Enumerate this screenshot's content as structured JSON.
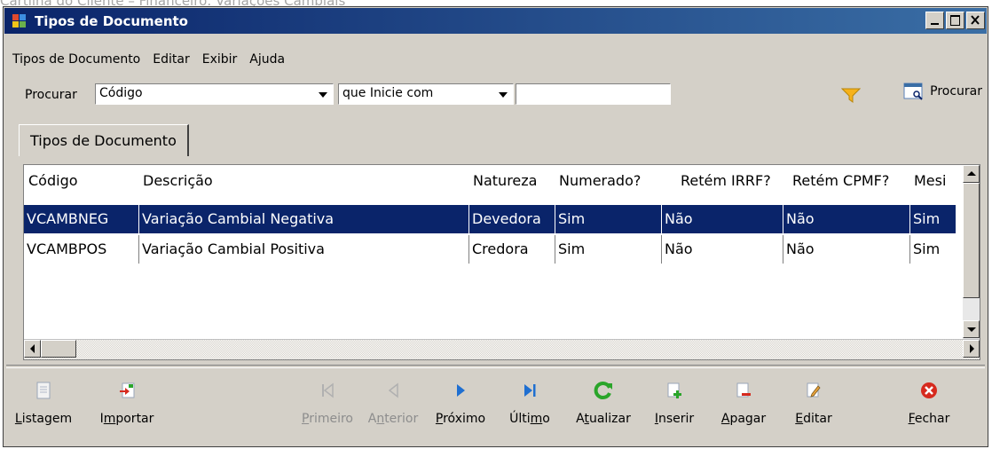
{
  "background_caption": "Cartilha do Cliente – Financeiro: Variações Cambiais",
  "window": {
    "title": "Tipos de Documento"
  },
  "menu": [
    "Tipos de Documento",
    "Editar",
    "Exibir",
    "Ajuda"
  ],
  "search": {
    "label": "Procurar",
    "field_value": "Código",
    "condition_value": "que Inicie com",
    "text_value": "",
    "button_label": "Procurar"
  },
  "tab": {
    "label": "Tipos de Documento"
  },
  "table": {
    "columns": [
      "Código",
      "Descrição",
      "Natureza",
      "Numerado?",
      "Retém IRRF?",
      "Retém CPMF?",
      "Mesi"
    ],
    "rows": [
      [
        "VCAMBNEG",
        "Variação Cambial Negativa",
        "Devedora",
        "Sim",
        "Não",
        "Não",
        "Sim"
      ],
      [
        "VCAMBPOS",
        "Variação Cambial Positiva",
        "Credora",
        "Sim",
        "Não",
        "Não",
        "Sim"
      ]
    ],
    "selected_row": 0
  },
  "toolbar": {
    "listagem": "Listagem",
    "importar": "Importar",
    "primeiro": "Primeiro",
    "anterior": "Anterior",
    "proximo": "Próximo",
    "ultimo": "Último",
    "atualizar": "Atualizar",
    "inserir": "Inserir",
    "apagar": "Apagar",
    "editar": "Editar",
    "fechar": "Fechar"
  },
  "colors": {
    "title_start": "#0a246a",
    "title_end": "#3a6ea5",
    "selection": "#0a246a",
    "face": "#d4d0c8",
    "nav_blue": "#1f6fd1",
    "refresh_green": "#2aa52a",
    "close_red": "#d62a1e"
  }
}
